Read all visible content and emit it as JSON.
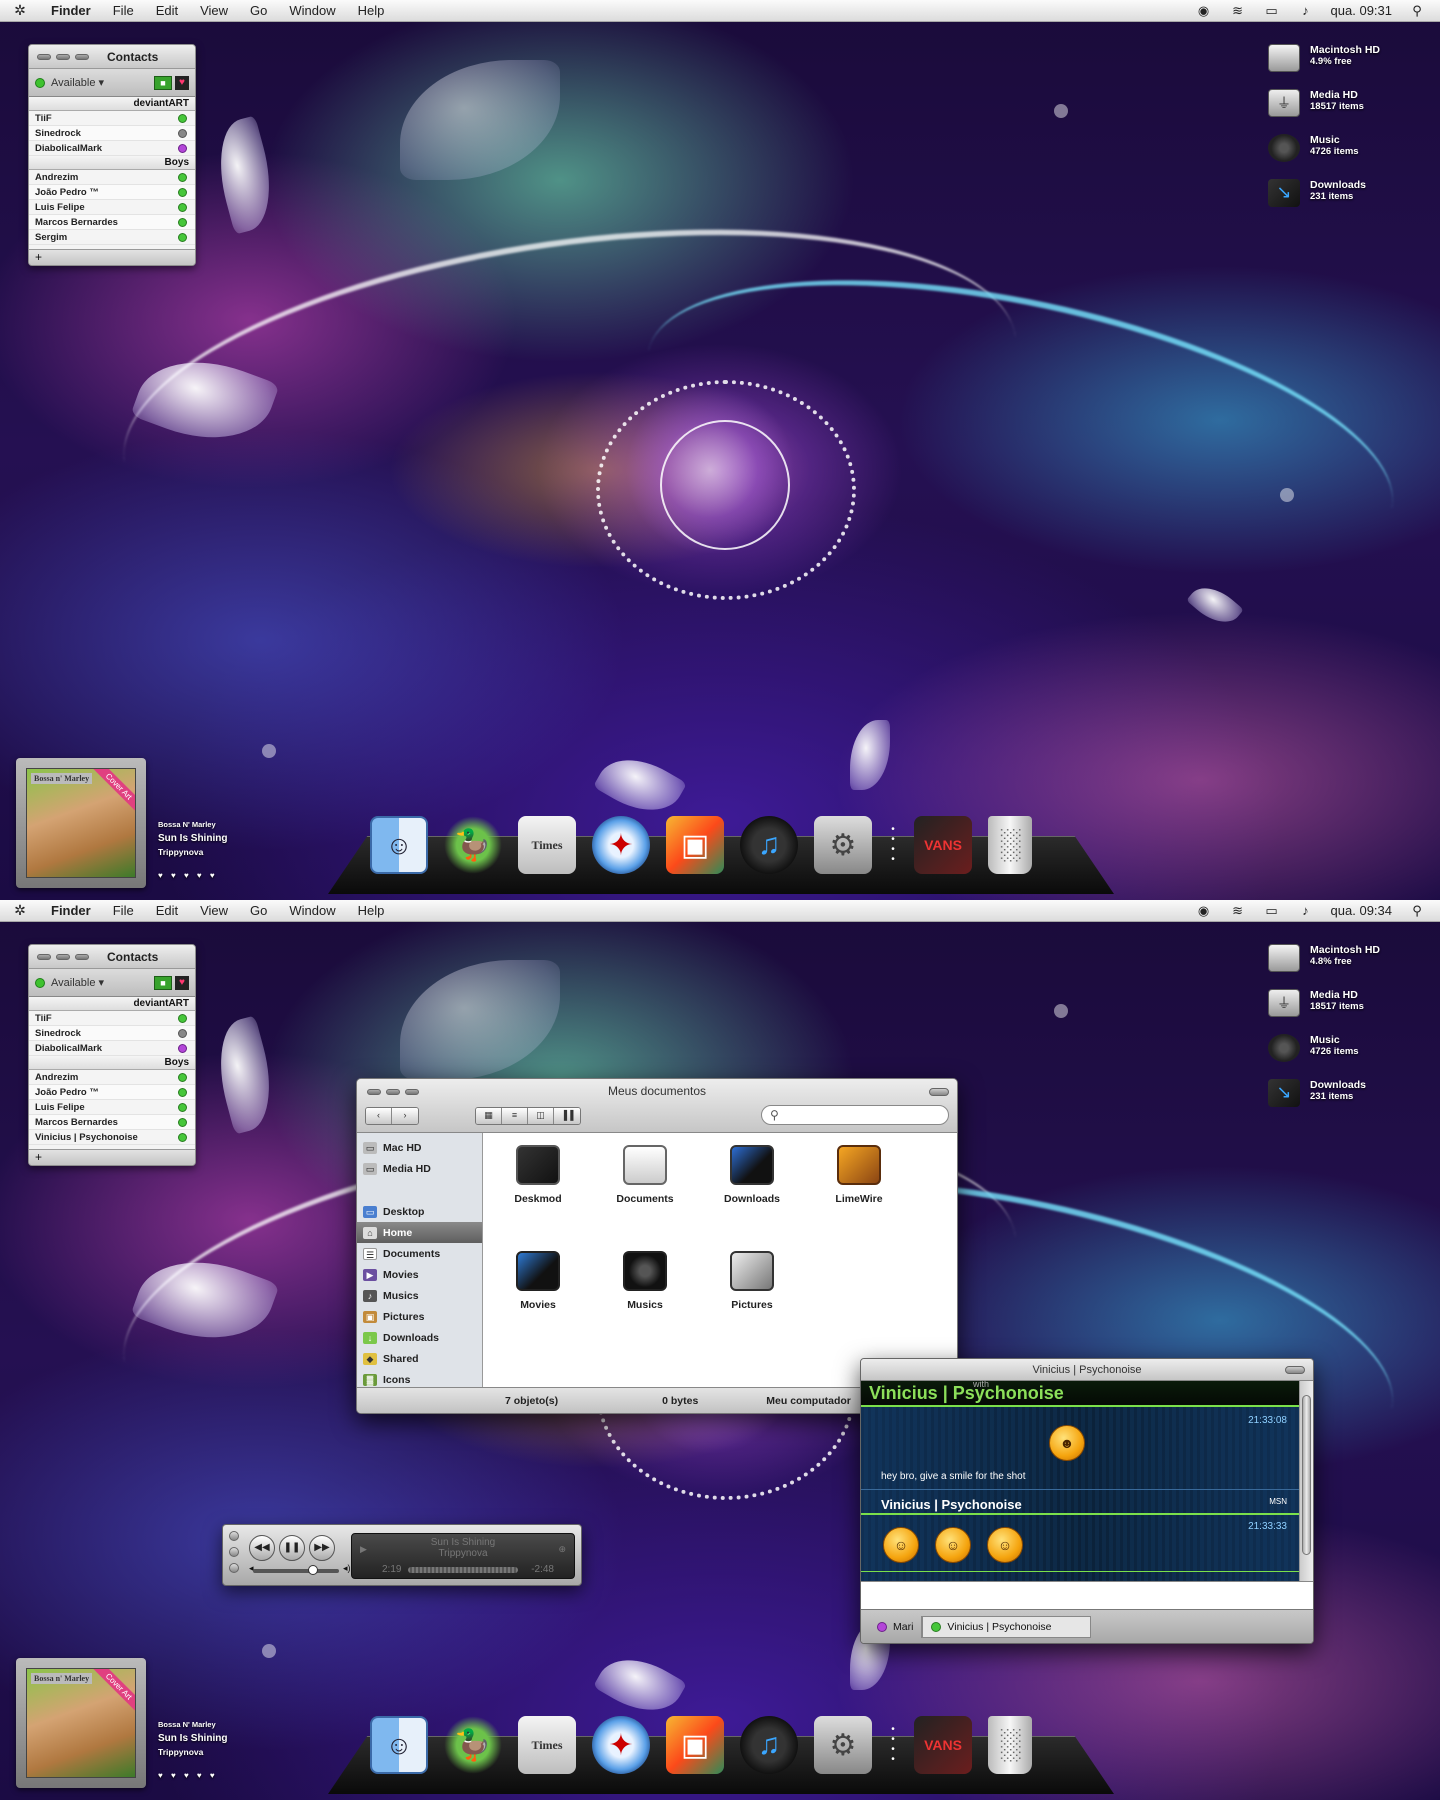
{
  "screens": [
    {
      "menubar": {
        "app_name": "Finder",
        "menus": [
          "File",
          "Edit",
          "View",
          "Go",
          "Window",
          "Help"
        ],
        "clock": "qua. 09:31"
      },
      "contacts": {
        "title": "Contacts",
        "status": "Available ▾",
        "groups": [
          {
            "name": "deviantART",
            "contacts": [
              {
                "name": "TiiF",
                "status": "green"
              },
              {
                "name": "Sinedrock",
                "status": "gray"
              },
              {
                "name": "DiabolicalMark",
                "status": "purple"
              }
            ]
          },
          {
            "name": "Boys",
            "contacts": [
              {
                "name": "Andrezim",
                "status": "green"
              },
              {
                "name": "João Pedro ™",
                "status": "green"
              },
              {
                "name": "Luis Felipe",
                "status": "green"
              },
              {
                "name": "Marcos Bernardes",
                "status": "green"
              },
              {
                "name": "Sergim",
                "status": "green"
              }
            ]
          }
        ],
        "add_label": "+"
      },
      "volumes": [
        {
          "name": "Macintosh HD",
          "detail": "4.9% free",
          "icon": "hd"
        },
        {
          "name": "Media HD",
          "detail": "18517 items",
          "icon": "usb"
        },
        {
          "name": "Music",
          "detail": "4726 items",
          "icon": "music"
        },
        {
          "name": "Downloads",
          "detail": "231 items",
          "icon": "dl"
        }
      ]
    },
    {
      "menubar": {
        "app_name": "Finder",
        "menus": [
          "File",
          "Edit",
          "View",
          "Go",
          "Window",
          "Help"
        ],
        "clock": "qua. 09:34"
      },
      "contacts": {
        "title": "Contacts",
        "status": "Available ▾",
        "groups": [
          {
            "name": "deviantART",
            "contacts": [
              {
                "name": "TiiF",
                "status": "green"
              },
              {
                "name": "Sinedrock",
                "status": "gray"
              },
              {
                "name": "DiabolicalMark",
                "status": "purple"
              }
            ]
          },
          {
            "name": "Boys",
            "contacts": [
              {
                "name": "Andrezim",
                "status": "green"
              },
              {
                "name": "João Pedro ™",
                "status": "green"
              },
              {
                "name": "Luis Felipe",
                "status": "green"
              },
              {
                "name": "Marcos Bernardes",
                "status": "green"
              },
              {
                "name": "Vinicius | Psychonoise",
                "status": "green"
              }
            ]
          }
        ],
        "add_label": "+"
      },
      "volumes": [
        {
          "name": "Macintosh HD",
          "detail": "4.8% free",
          "icon": "hd"
        },
        {
          "name": "Media HD",
          "detail": "18517 items",
          "icon": "usb"
        },
        {
          "name": "Music",
          "detail": "4726 items",
          "icon": "music"
        },
        {
          "name": "Downloads",
          "detail": "231 items",
          "icon": "dl"
        }
      ]
    }
  ],
  "cover_widget": {
    "album_art_title": "Bossa n' Marley",
    "ribbon": "Cover Art",
    "artist": "Bossa N' Marley",
    "song": "Sun Is Shining",
    "album": "Trippynova",
    "rating": "♥ ♥ ♥ ♥ ♥"
  },
  "dock": [
    {
      "name": "finder",
      "glyph": "☺"
    },
    {
      "name": "adium",
      "glyph": "🦆"
    },
    {
      "name": "news",
      "glyph": "Times"
    },
    {
      "name": "safari",
      "glyph": "✦"
    },
    {
      "name": "photos",
      "glyph": "▣"
    },
    {
      "name": "itunes",
      "glyph": "♫"
    },
    {
      "name": "prefs",
      "glyph": "⚙"
    },
    {
      "name": "sep",
      "glyph": "•"
    },
    {
      "name": "vans",
      "glyph": "VANS"
    },
    {
      "name": "trash",
      "glyph": "░"
    }
  ],
  "finder_window": {
    "title": "Meus documentos",
    "nav_buttons": [
      "‹",
      "›"
    ],
    "view_buttons": [
      "▦",
      "≡",
      "◫",
      "▐▐"
    ],
    "search_glyph": "⚲",
    "sidebar": [
      {
        "label": "Mac HD",
        "icon": "▭",
        "color": "#888"
      },
      {
        "label": "Media HD",
        "icon": "▭",
        "color": "#888"
      },
      {
        "label": "Desktop",
        "icon": "▭",
        "color": "#4a7fd0",
        "gap": true
      },
      {
        "label": "Home",
        "icon": "⌂",
        "color": "#ddd",
        "selected": true
      },
      {
        "label": "Documents",
        "icon": "☰",
        "color": "#eee"
      },
      {
        "label": "Movies",
        "icon": "▶",
        "color": "#6b4fa0"
      },
      {
        "label": "Musics",
        "icon": "♪",
        "color": "#555"
      },
      {
        "label": "Pictures",
        "icon": "▣",
        "color": "#c28a3a"
      },
      {
        "label": "Downloads",
        "icon": "↓",
        "color": "#7bc84a"
      },
      {
        "label": "Shared",
        "icon": "◆",
        "color": "#e0c040"
      },
      {
        "label": "Icons",
        "icon": "▓",
        "color": "#6a9a3a"
      }
    ],
    "files": [
      {
        "label": "Deskmod",
        "icon": "deskmod"
      },
      {
        "label": "Documents",
        "icon": "documents"
      },
      {
        "label": "Downloads",
        "icon": "downloads"
      },
      {
        "label": "LimeWire",
        "icon": "limewire"
      },
      {
        "label": "Movies",
        "icon": "movies"
      },
      {
        "label": "Musics",
        "icon": "musics"
      },
      {
        "label": "Pictures",
        "icon": "pictures"
      }
    ],
    "status": {
      "items": "7 objeto(s)",
      "size": "0 bytes",
      "location": "Meu computador"
    }
  },
  "chat_window": {
    "title": "Vinicius | Psychonoise",
    "with_label": "with",
    "header_name": "Vinicius | Psychonoise",
    "messages": [
      {
        "time": "21:33:08",
        "text": "hey bro, give a smile for the shot"
      },
      {
        "sender": "Vinicius | Psychonoise",
        "service": "MSN",
        "time": "21:33:33"
      }
    ],
    "tabs": [
      {
        "label": "Mari",
        "status": "purple"
      },
      {
        "label": "Vinicius | Psychonoise",
        "status": "green"
      }
    ]
  },
  "itunes_mini": {
    "song": "Sun Is Shining",
    "album": "Trippynova",
    "elapsed": "2:19",
    "remaining": "-2:48",
    "controls": [
      "◀◀",
      "❚❚",
      "▶▶"
    ],
    "volume_level": 0.7
  }
}
